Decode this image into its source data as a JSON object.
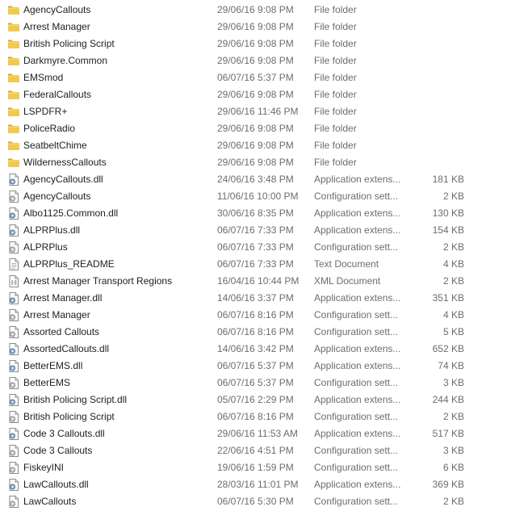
{
  "window": {
    "view": "details"
  },
  "icons": {
    "folder": "folder-icon",
    "dll": "dll-file-icon",
    "config": "config-file-icon",
    "text": "text-document-icon",
    "xml": "xml-document-icon"
  },
  "colors": {
    "folder_fill": "#f2c94c",
    "folder_edge": "#d7a52c",
    "meta_text": "#6d6d6d",
    "name_text": "#1e1e1e"
  },
  "files": [
    {
      "name": "AgencyCallouts",
      "date": "29/06/16 9:08 PM",
      "type": "File folder",
      "size": "",
      "icon": "folder"
    },
    {
      "name": "Arrest Manager",
      "date": "29/06/16 9:08 PM",
      "type": "File folder",
      "size": "",
      "icon": "folder"
    },
    {
      "name": "British Policing Script",
      "date": "29/06/16 9:08 PM",
      "type": "File folder",
      "size": "",
      "icon": "folder"
    },
    {
      "name": "Darkmyre.Common",
      "date": "29/06/16 9:08 PM",
      "type": "File folder",
      "size": "",
      "icon": "folder"
    },
    {
      "name": "EMSmod",
      "date": "06/07/16 5:37 PM",
      "type": "File folder",
      "size": "",
      "icon": "folder"
    },
    {
      "name": "FederalCallouts",
      "date": "29/06/16 9:08 PM",
      "type": "File folder",
      "size": "",
      "icon": "folder"
    },
    {
      "name": "LSPDFR+",
      "date": "29/06/16 11:46 PM",
      "type": "File folder",
      "size": "",
      "icon": "folder"
    },
    {
      "name": "PoliceRadio",
      "date": "29/06/16 9:08 PM",
      "type": "File folder",
      "size": "",
      "icon": "folder"
    },
    {
      "name": "SeatbeltChime",
      "date": "29/06/16 9:08 PM",
      "type": "File folder",
      "size": "",
      "icon": "folder"
    },
    {
      "name": "WildernessCallouts",
      "date": "29/06/16 9:08 PM",
      "type": "File folder",
      "size": "",
      "icon": "folder"
    },
    {
      "name": "AgencyCallouts.dll",
      "date": "24/06/16 3:48 PM",
      "type": "Application extens...",
      "size": "181 KB",
      "icon": "dll"
    },
    {
      "name": "AgencyCallouts",
      "date": "11/06/16 10:00 PM",
      "type": "Configuration sett...",
      "size": "2 KB",
      "icon": "config"
    },
    {
      "name": "Albo1125.Common.dll",
      "date": "30/06/16 8:35 PM",
      "type": "Application extens...",
      "size": "130 KB",
      "icon": "dll"
    },
    {
      "name": "ALPRPlus.dll",
      "date": "06/07/16 7:33 PM",
      "type": "Application extens...",
      "size": "154 KB",
      "icon": "dll"
    },
    {
      "name": "ALPRPlus",
      "date": "06/07/16 7:33 PM",
      "type": "Configuration sett...",
      "size": "2 KB",
      "icon": "config"
    },
    {
      "name": "ALPRPlus_README",
      "date": "06/07/16 7:33 PM",
      "type": "Text Document",
      "size": "4 KB",
      "icon": "text"
    },
    {
      "name": "Arrest Manager Transport Regions",
      "date": "16/04/16 10:44 PM",
      "type": "XML Document",
      "size": "2 KB",
      "icon": "xml"
    },
    {
      "name": "Arrest Manager.dll",
      "date": "14/06/16 3:37 PM",
      "type": "Application extens...",
      "size": "351 KB",
      "icon": "dll"
    },
    {
      "name": "Arrest Manager",
      "date": "06/07/16 8:16 PM",
      "type": "Configuration sett...",
      "size": "4 KB",
      "icon": "config"
    },
    {
      "name": "Assorted Callouts",
      "date": "06/07/16 8:16 PM",
      "type": "Configuration sett...",
      "size": "5 KB",
      "icon": "config"
    },
    {
      "name": "AssortedCallouts.dll",
      "date": "14/06/16 3:42 PM",
      "type": "Application extens...",
      "size": "652 KB",
      "icon": "dll"
    },
    {
      "name": "BetterEMS.dll",
      "date": "06/07/16 5:37 PM",
      "type": "Application extens...",
      "size": "74 KB",
      "icon": "dll"
    },
    {
      "name": "BetterEMS",
      "date": "06/07/16 5:37 PM",
      "type": "Configuration sett...",
      "size": "3 KB",
      "icon": "config"
    },
    {
      "name": "British Policing Script.dll",
      "date": "05/07/16 2:29 PM",
      "type": "Application extens...",
      "size": "244 KB",
      "icon": "dll"
    },
    {
      "name": "British Policing Script",
      "date": "06/07/16 8:16 PM",
      "type": "Configuration sett...",
      "size": "2 KB",
      "icon": "config"
    },
    {
      "name": "Code 3 Callouts.dll",
      "date": "29/06/16 11:53 AM",
      "type": "Application extens...",
      "size": "517 KB",
      "icon": "dll"
    },
    {
      "name": "Code 3 Callouts",
      "date": "22/06/16 4:51 PM",
      "type": "Configuration sett...",
      "size": "3 KB",
      "icon": "config"
    },
    {
      "name": "FiskeyINI",
      "date": "19/06/16 1:59 PM",
      "type": "Configuration sett...",
      "size": "6 KB",
      "icon": "config"
    },
    {
      "name": "LawCallouts.dll",
      "date": "28/03/16 11:01 PM",
      "type": "Application extens...",
      "size": "369 KB",
      "icon": "dll"
    },
    {
      "name": "LawCallouts",
      "date": "06/07/16 5:30 PM",
      "type": "Configuration sett...",
      "size": "2 KB",
      "icon": "config"
    }
  ]
}
